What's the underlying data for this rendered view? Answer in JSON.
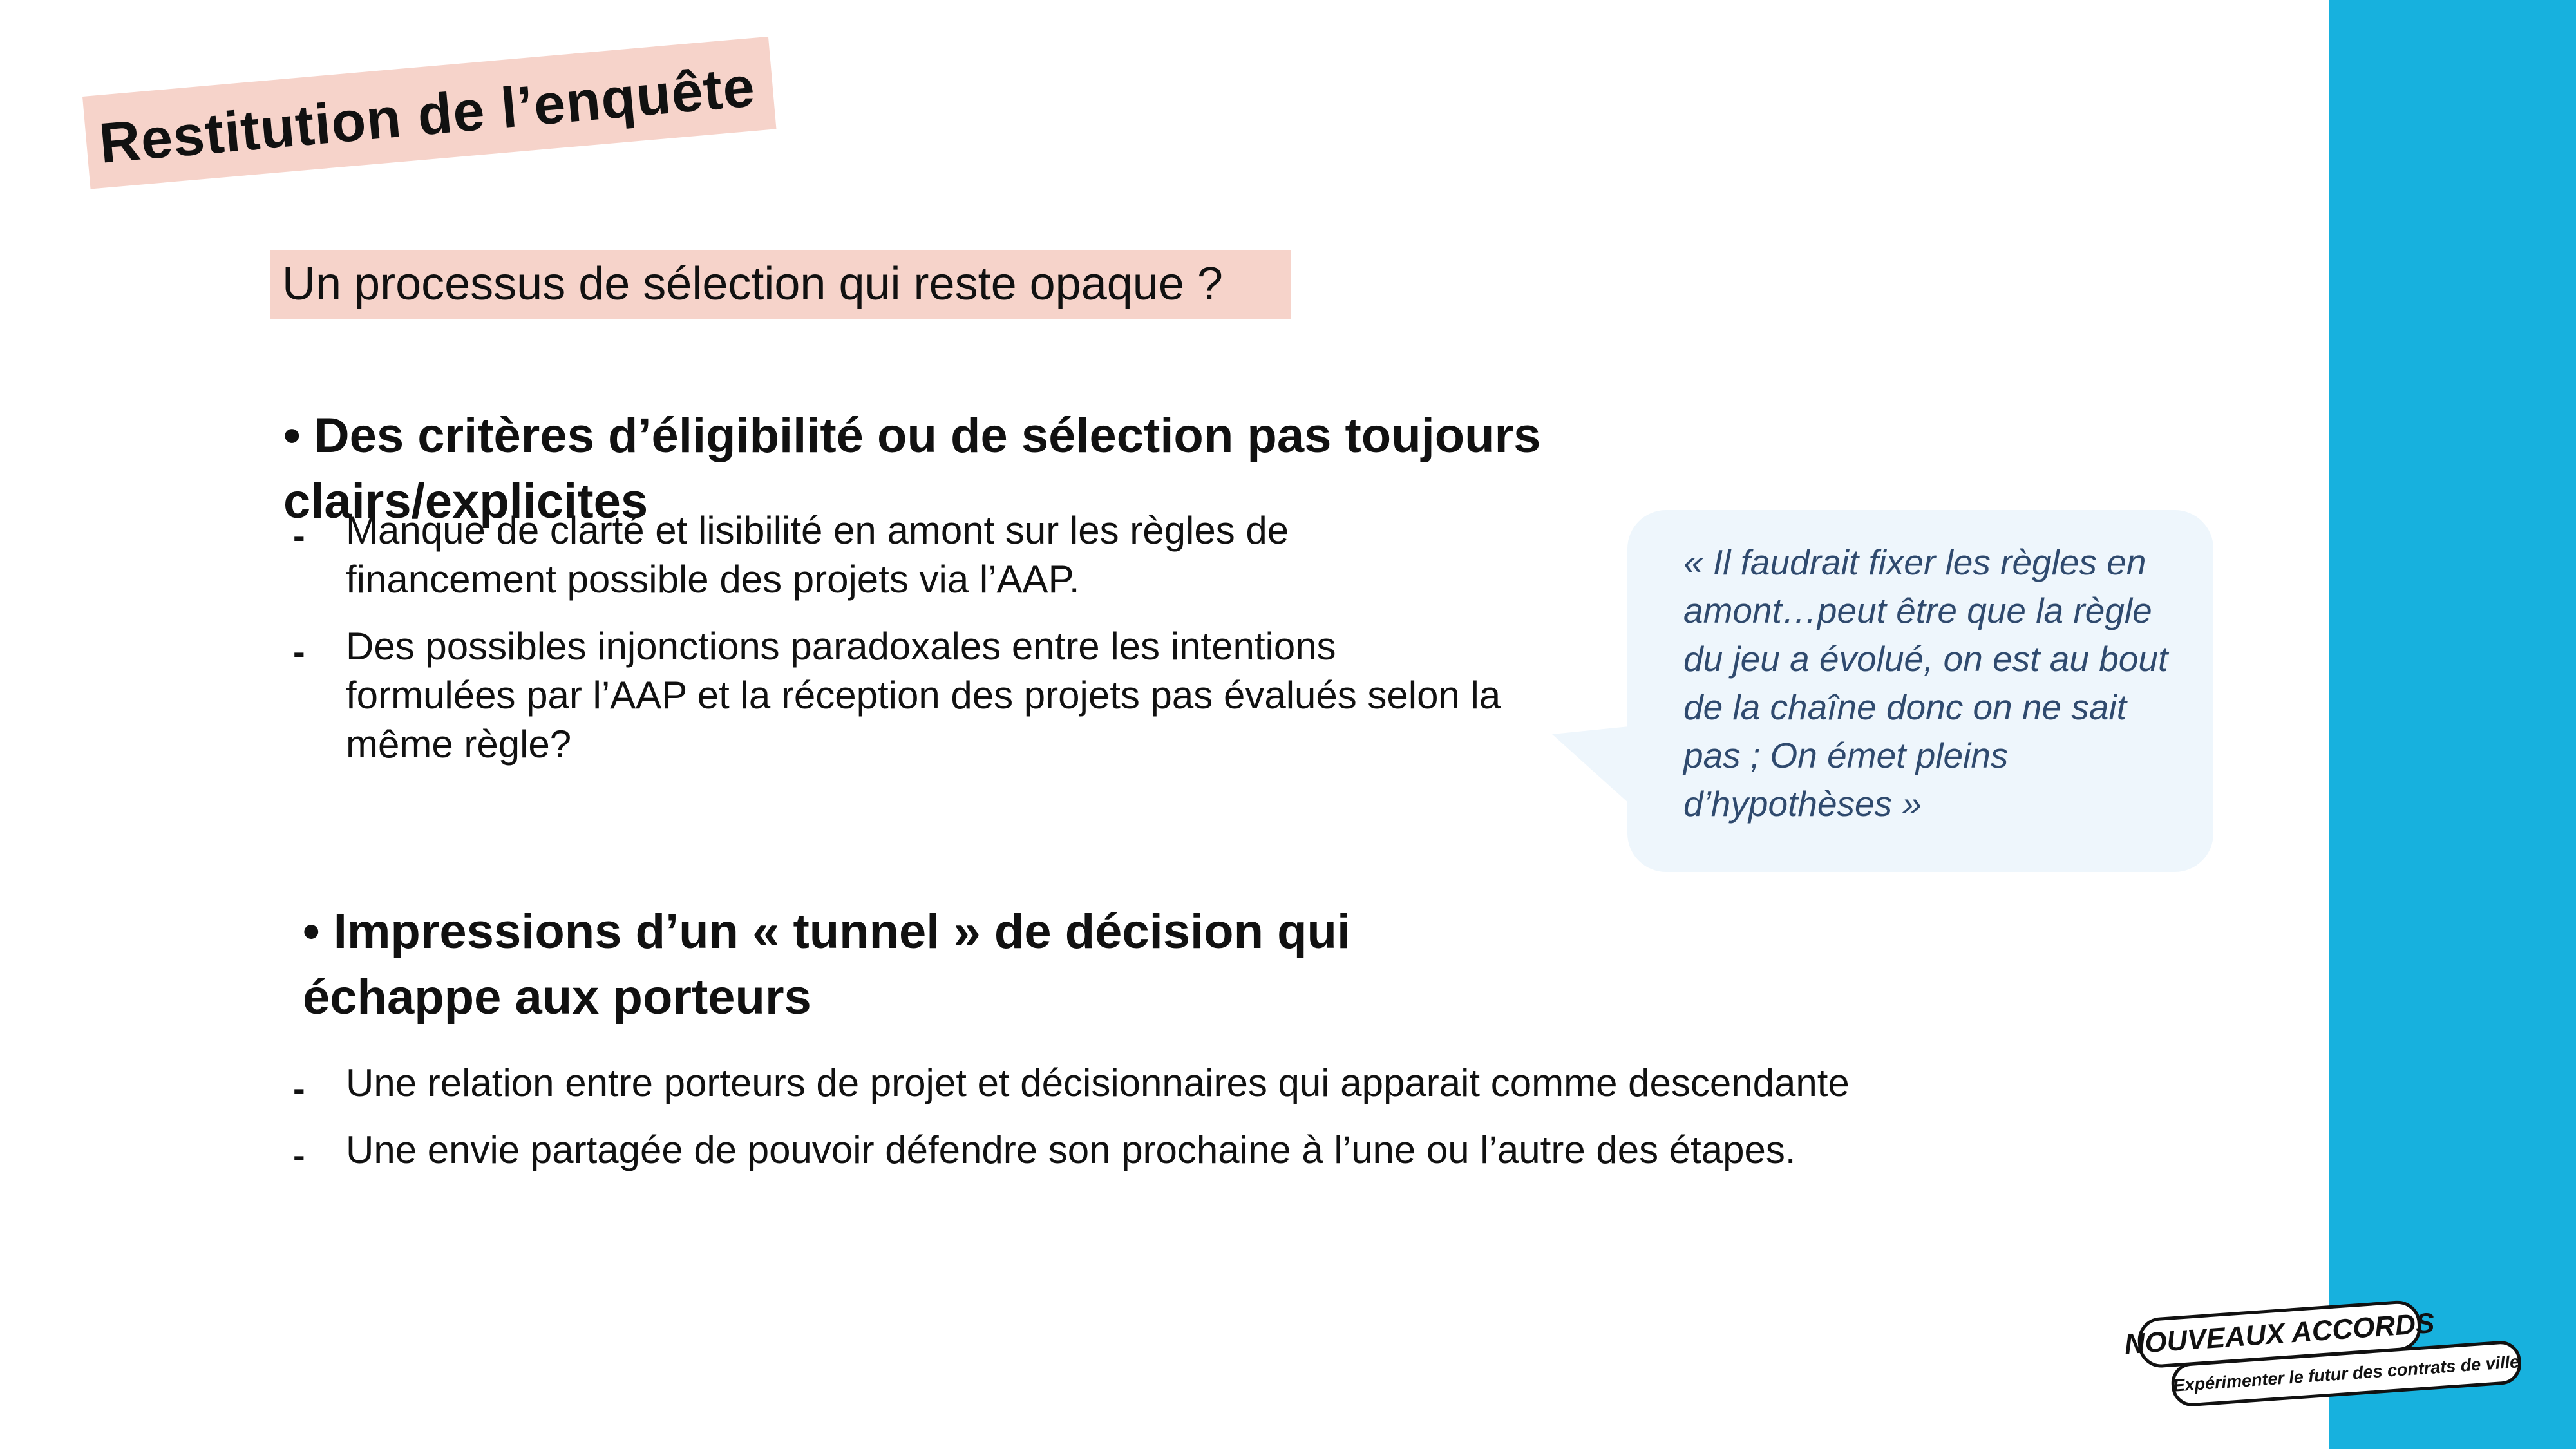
{
  "slide": {
    "title": "Restitution de l’enquête",
    "subtitle": "Un processus de sélection qui reste opaque ?"
  },
  "section1": {
    "heading": "• Des critères d’éligibilité ou de sélection pas toujours clairs/explicites",
    "items": [
      {
        "dash": "-",
        "text": "Manque de clarté et lisibilité en amont sur les règles de financement possible des projets via l’AAP."
      },
      {
        "dash": "-",
        "text": "Des possibles injonctions paradoxales entre les intentions formulées par l’AAP et la réception des projets pas évalués selon la même règle?"
      }
    ]
  },
  "quote": {
    "text": "« Il faudrait fixer les règles en amont…peut être que la règle du jeu a évolué, on est au bout de la chaîne donc on ne sait pas ; On émet pleins d’hypothèses »"
  },
  "section2": {
    "heading": "• Impressions d’un « tunnel » de décision qui échappe aux porteurs",
    "items": [
      {
        "dash": "-",
        "text": "Une relation entre porteurs de projet et décisionnaires qui apparait comme descendante"
      },
      {
        "dash": "-",
        "text": "Une envie partagée de pouvoir défendre son prochaine à l’une ou l’autre des étapes."
      }
    ]
  },
  "logo": {
    "name": "NOUVEAUX ACCORDS",
    "tagline": "Expérimenter le futur des contrats de ville"
  },
  "colors": {
    "sidebar": "#17b1de",
    "highlight": "#f6d3ca",
    "quote_bg": "#eef6fc",
    "quote_text": "#2f4a6e"
  }
}
